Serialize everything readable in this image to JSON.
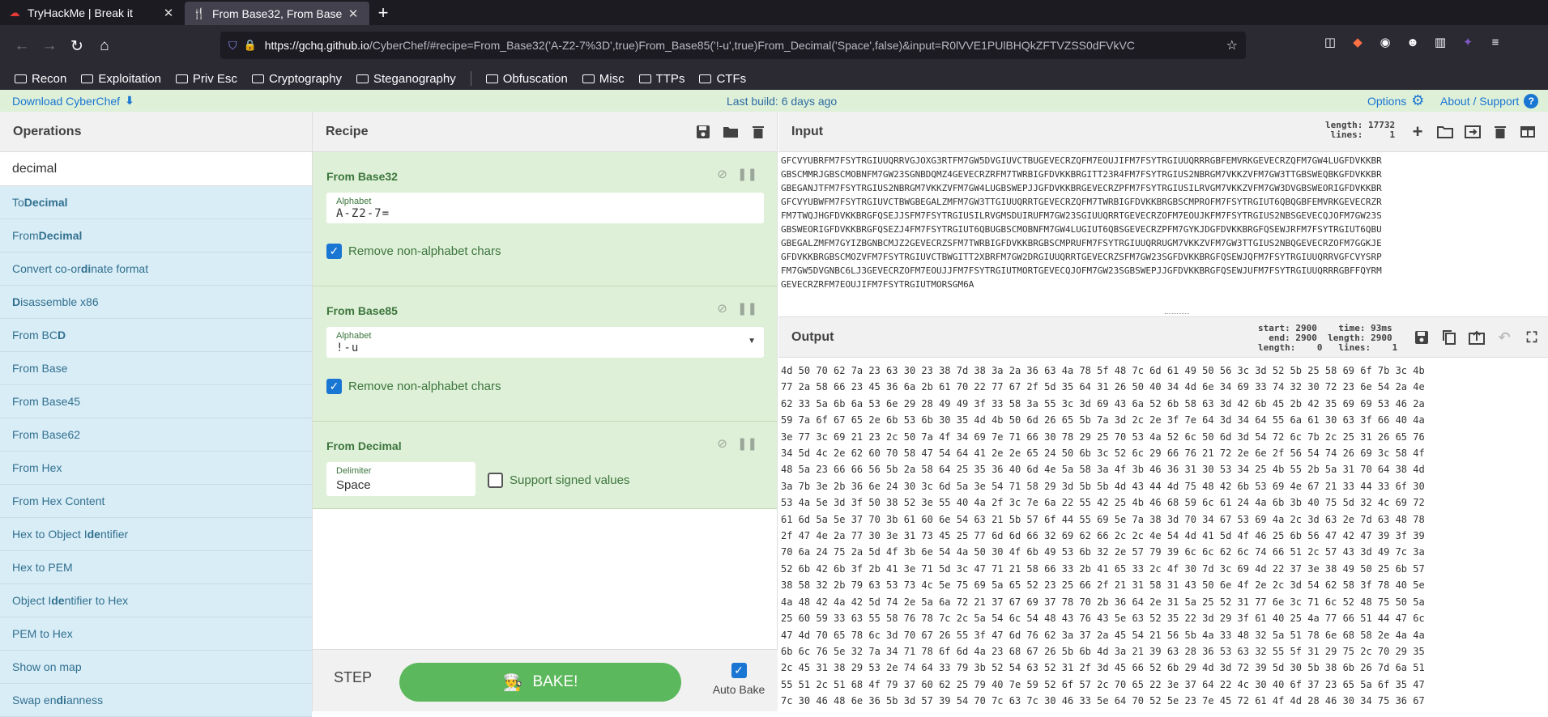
{
  "browser": {
    "tabs": [
      {
        "title": "TryHackMe | Break it",
        "icon": "tryhackme-icon"
      },
      {
        "title": "From Base32, From Base",
        "icon": "cyberchef-icon"
      }
    ],
    "url_host": "https://gchq.github.io",
    "url_rest": "/CyberChef/#recipe=From_Base32('A-Z2-7%3D',true)From_Base85('!-u',true)From_Decimal('Space',false)&input=R0lVVE1PUlBHQkZFTVZSS0dFVkVC",
    "bookmarks": [
      "Recon",
      "Exploitation",
      "Priv Esc",
      "Cryptography",
      "Steganography",
      "Obfuscation",
      "Misc",
      "TTPs",
      "CTFs"
    ]
  },
  "banner": {
    "download": "Download CyberChef",
    "build": "Last build: 6 days ago",
    "options": "Options",
    "about": "About / Support"
  },
  "operations": {
    "title": "Operations",
    "search": "decimal",
    "items": [
      [
        "To ",
        "Decimal",
        ""
      ],
      [
        "From ",
        "Decimal",
        ""
      ],
      [
        "Convert co-or",
        "di",
        "nate format"
      ],
      [
        "",
        "D",
        "isassemble x86"
      ],
      [
        "From BC",
        "D",
        ""
      ],
      [
        "From Base",
        "",
        ""
      ],
      [
        "From Base45",
        "",
        ""
      ],
      [
        "From Base62",
        "",
        ""
      ],
      [
        "From Hex",
        "",
        ""
      ],
      [
        "From Hex Content",
        "",
        ""
      ],
      [
        "Hex to Object I",
        "de",
        "ntifier"
      ],
      [
        "Hex to PEM",
        "",
        ""
      ],
      [
        "Object I",
        "de",
        "ntifier to Hex"
      ],
      [
        "PEM to Hex",
        "",
        ""
      ],
      [
        "Show on map",
        "",
        ""
      ],
      [
        "Swap en",
        "di",
        "anness"
      ]
    ]
  },
  "recipe": {
    "title": "Recipe",
    "ingredients": [
      {
        "name": "From Base32",
        "field_label": "Alphabet",
        "field_value": "A-Z2-7=",
        "check_label": "Remove non-alphabet chars"
      },
      {
        "name": "From Base85",
        "field_label": "Alphabet",
        "field_value": "!-u",
        "check_label": "Remove non-alphabet chars"
      },
      {
        "name": "From Decimal",
        "field_label": "Delimiter",
        "field_value": "Space",
        "check_label": "Support signed values"
      }
    ],
    "step": "STEP",
    "bake": "BAKE!",
    "autobake": "Auto Bake"
  },
  "input": {
    "title": "Input",
    "stats": "length: 17732\n lines:     1",
    "text": "GFCVYUBRFM7FSYTRGIUUQRRVGJOXG3RTFM7GW5DVGIUVCTBUGEVECRZQFM7EOUJIFM7FSYTRGIUUQRRRGBFEMVRKGEVECRZQFM7GW4LUGFDVKKBR\nGBSCMMRJGBSCMOBNFM7GW23SGNBDQMZ4GEVECRZRFM7TWRBIGFDVKKBRGITT23R4FM7FSYTRGIUS2NBRGM7VKKZVFM7GW3TTGBSWEQBKGFDVKKBR\nGBEGANJTFM7FSYTRGIUS2NBRGM7VKKZVFM7GW4LUGBSWEPJJGFDVKKBRGEVECRZPFM7FSYTRGIUSILRVGM7VKKZVFM7GW3DVGBSWEORIGFDVKKBR\nGFCVYUBWFM7FSYTRGIUVCTBWGBEGALZMFM7GW3TTGIUUQRRTGEVECRZQFM7TWRBIGFDVKKBRGBSCMPROFM7FSYTRGIUT6QBQGBFEMVRKGEVECRZR\nFM7TWQJHGFDVKKBRGFQSEJJSFM7FSYTRGIUSILRVGMSDUIRUFM7GW23SGIUUQRRTGEVECRZOFM7EOUJKFM7FSYTRGIUS2NBSGEVECQJOFM7GW23S\nGBSWEORIGFDVKKBRGFQSEZJ4FM7FSYTRGIUT6QBUGBSCMOBNFM7GW4LUGIUT6QBSGEVECRZPFM7GYKJDGFDVKKBRGFQSEWJRFM7FSYTRGIUT6QBU\nGBEGALZMFM7GYIZBGNBCMJZ2GEVECRZSFM7TWRBIGFDVKKBRGBSCMPRUFM7FSYTRGIUUQRRUGM7VKKZVFM7GW3TTGIUS2NBQGEVECRZOFM7GGKJE\nGFDVKKBRGBSCMOZVFM7FSYTRGIUVCTBWGITT2XBRFM7GW2DRGIUUQRRTGEVECRZSFM7GW23SGFDVKKBRGFQSEWJQFM7FSYTRGIUUQRRVGFCVYSRP\nFM7GW5DVGNBC6LJ3GEVECRZOFM7EOUJJFM7FSYTRGIUTMORTGEVECQJOFM7GW23SGBSWEPJJGFDVKKBRGFQSEWJUFM7FSYTRGIUUQRRRGBFFQYRM\nGEVECRZRFM7EOUJIFM7FSYTRGIUTMORSGM6A"
  },
  "output": {
    "title": "Output",
    "stats": "start: 2900    time: 93ms\n  end: 2900  length: 2900\nlength:    0   lines:    1",
    "text": "4d 50 70 62 7a 23 63 30 23 38 7d 38 3a 2a 36 63 4a 78 5f 48 7c 6d 61 49 50 56 3c 3d 52 5b 25 58 69 6f 7b 3c 4b\n77 2a 58 66 23 45 36 6a 2b 61 70 22 77 67 2f 5d 35 64 31 26 50 40 34 4d 6e 34 69 33 74 32 30 72 23 6e 54 2a 4e\n62 33 5a 6b 6a 53 6e 29 28 49 49 3f 33 58 3a 55 3c 3d 69 43 6a 52 6b 58 63 3d 42 6b 45 2b 42 35 69 69 53 46 2a\n59 7a 6f 67 65 2e 6b 53 6b 30 35 4d 4b 50 6d 26 65 5b 7a 3d 2c 2e 3f 7e 64 3d 34 64 55 6a 61 30 63 3f 66 40 4a\n3e 77 3c 69 21 23 2c 50 7a 4f 34 69 7e 71 66 30 78 29 25 70 53 4a 52 6c 50 6d 3d 54 72 6c 7b 2c 25 31 26 65 76\n34 5d 4c 2e 62 60 70 58 47 54 64 41 2e 2e 65 24 50 6b 3c 52 6c 29 66 76 21 72 2e 6e 2f 56 54 74 26 69 3c 58 4f\n48 5a 23 66 66 56 5b 2a 58 64 25 35 36 40 6d 4e 5a 58 3a 4f 3b 46 36 31 30 53 34 25 4b 55 2b 5a 31 70 64 38 4d\n3a 7b 3e 2b 36 6e 24 30 3c 6d 5a 3e 54 71 58 29 3d 5b 5b 4d 43 44 4d 75 48 42 6b 53 69 4e 67 21 33 44 33 6f 30\n53 4a 5e 3d 3f 50 38 52 3e 55 40 4a 2f 3c 7e 6a 22 55 42 25 4b 46 68 59 6c 61 24 4a 6b 3b 40 75 5d 32 4c 69 72\n61 6d 5a 5e 37 70 3b 61 60 6e 54 63 21 5b 57 6f 44 55 69 5e 7a 38 3d 70 34 67 53 69 4a 2c 3d 63 2e 7d 63 48 78\n2f 47 4e 2a 77 30 3e 31 73 45 25 77 6d 6d 66 32 69 62 66 2c 2c 4e 54 4d 41 5d 4f 46 25 6b 56 47 42 47 39 3f 39\n70 6a 24 75 2a 5d 4f 3b 6e 54 4a 50 30 4f 6b 49 53 6b 32 2e 57 79 39 6c 6c 62 6c 74 66 51 2c 57 43 3d 49 7c 3a\n52 6b 42 6b 3f 2b 41 3e 71 5d 3c 47 71 21 58 66 33 2b 41 65 33 2c 4f 30 7d 3c 69 4d 22 37 3e 38 49 50 25 6b 57\n38 58 32 2b 79 63 53 73 4c 5e 75 69 5a 65 52 23 25 66 2f 21 31 58 31 43 50 6e 4f 2e 2c 3d 54 62 58 3f 78 40 5e\n4a 48 42 4a 42 5d 74 2e 5a 6a 72 21 37 67 69 37 78 70 2b 36 64 2e 31 5a 25 52 31 77 6e 3c 71 6c 52 48 75 50 5a\n25 60 59 33 63 55 58 76 78 7c 2c 5a 54 6c 54 48 43 76 43 5e 63 52 35 22 3d 29 3f 61 40 25 4a 77 66 51 44 47 6c\n47 4d 70 65 78 6c 3d 70 67 26 55 3f 47 6d 76 62 3a 37 2a 45 54 21 56 5b 4a 33 48 32 5a 51 78 6e 68 58 2e 4a 4a\n6b 6c 76 5e 32 7a 34 71 78 6f 6d 4a 23 68 67 26 5b 6b 4d 3a 21 39 63 28 36 53 63 32 55 5f 31 29 75 2c 70 29 35\n2c 45 31 38 29 53 2e 74 64 33 79 3b 52 54 63 52 31 2f 3d 45 66 52 6b 29 4d 3d 72 39 5d 30 5b 38 6b 26 7d 6a 51\n55 51 2c 51 68 4f 79 37 60 62 25 79 40 7e 59 52 6f 57 2c 70 65 22 3e 37 64 22 4c 30 40 6f 37 23 65 5a 6f 35 47\n7c 30 46 48 6e 36 5b 3d 57 39 54 70 7c 63 7c 30 46 33 5e 64 70 52 5e 23 7e 45 72 61 4f 4d 28 46 30 34 75 36 67\n4d 56 66 5f 50 57 63 45 23 64 48 6a 60 40 47 74 21 48 4a 4e 38 77 6f 26 74 43 3b 56 30 74 60 6a 35 3c 4c 67 70"
  }
}
